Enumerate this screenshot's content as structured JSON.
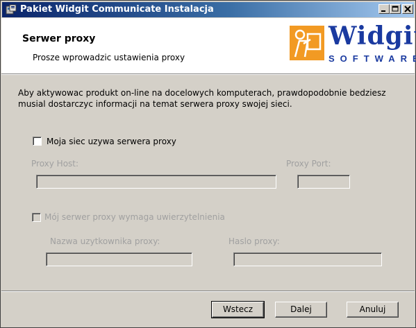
{
  "window": {
    "title": "Pakiet Widgit Communicate Instalacja",
    "icons": [
      "installer-icon",
      "minimize-icon",
      "maximize-icon",
      "close-icon"
    ]
  },
  "header": {
    "title": "Serwer proxy",
    "subtitle": "Prosze wprowadzic ustawienia proxy",
    "logo_text": "Widgit",
    "logo_subtext": "SOFTWARE",
    "logo_color": "#1a3aa0",
    "logo_accent": "#f29a23"
  },
  "description": "Aby aktywowac produkt on-line na docelowych komputerach, prawdopodobnie bedziesz musial dostarczyc informacji na temat serwera proxy swojej sieci.",
  "proxy": {
    "use_proxy_label": "Moja siec uzywa serwera proxy",
    "use_proxy_checked": false,
    "host_label": "Proxy Host:",
    "host_value": "",
    "port_label": "Proxy Port:",
    "port_value": ""
  },
  "auth": {
    "requires_auth_label": "Mój serwer proxy wymaga uwierzytelnienia",
    "requires_auth_checked": false,
    "username_label": "Nazwa uzytkownika proxy:",
    "username_value": "",
    "password_label": "Haslo proxy:",
    "password_value": ""
  },
  "buttons": {
    "back": "Wstecz",
    "next": "Dalej",
    "cancel": "Anuluj"
  }
}
